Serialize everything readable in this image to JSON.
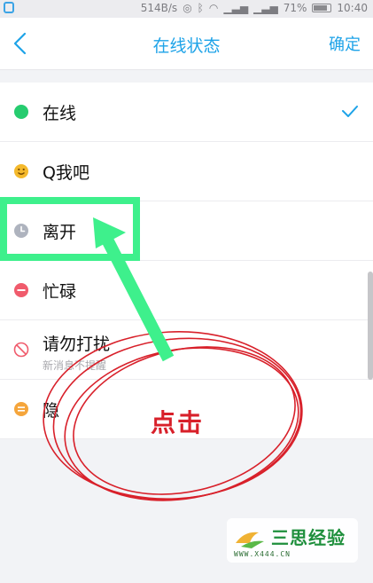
{
  "status_bar": {
    "speed": "514B/s",
    "battery_percent": "71%",
    "time": "10:40"
  },
  "nav": {
    "title": "在线状态",
    "confirm_label": "确定"
  },
  "statuses": [
    {
      "label": "在线",
      "icon": "green-dot-icon",
      "selected": true
    },
    {
      "label": "Q我吧",
      "icon": "smiley-icon"
    },
    {
      "label": "离开",
      "icon": "clock-icon"
    },
    {
      "label": "忙碌",
      "icon": "minus-icon"
    },
    {
      "label": "请勿打扰",
      "sublabel": "新消息不提醒",
      "icon": "no-entry-icon"
    },
    {
      "label": "隐",
      "icon": "list-icon"
    }
  ],
  "annotation": {
    "text": "点击"
  },
  "watermark": {
    "name": "三思经验",
    "url": "WWW.X444.CN"
  },
  "colors": {
    "accent": "#1ea3e8",
    "annotation_green": "#3ef08c",
    "annotation_red": "#d8202a"
  }
}
